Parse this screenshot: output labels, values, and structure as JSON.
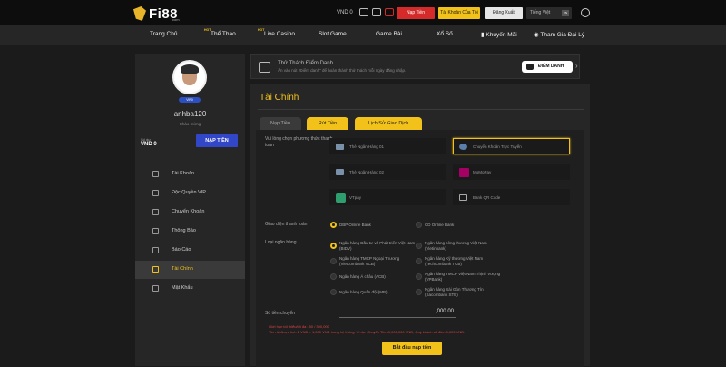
{
  "brand": {
    "name": "Fi88",
    "sub": "com"
  },
  "topbar": {
    "balance": "VND 0",
    "deposit_btn": "Nạp Tiền",
    "account_btn": "Tài Khoản Của Tôi",
    "logout_btn": "Đăng Xuất",
    "lang_btn": "Tiếng Việt",
    "lang_code": "VN"
  },
  "nav": [
    {
      "label": "Trang Chủ",
      "tag": ""
    },
    {
      "label": "Thể Thao",
      "tag": "HOT"
    },
    {
      "label": "Live Casino",
      "tag": "HOT"
    },
    {
      "label": "Slot Game",
      "tag": ""
    },
    {
      "label": "Game Bài",
      "tag": ""
    },
    {
      "label": "Xổ Số",
      "tag": ""
    },
    {
      "label": "Khuyến Mãi",
      "tag": ""
    },
    {
      "label": "Tham Gia Đại Lý",
      "tag": ""
    }
  ],
  "sidebar": {
    "vip": "VIP0",
    "username": "anhba120",
    "greeting": "Chào mừng",
    "balance_label": "Số dư",
    "balance_value": "VND 0",
    "deposit_btn": "NẠP TIỀN",
    "menu": [
      "Tài Khoản",
      "Độc Quyền VIP",
      "Chuyển Khoản",
      "Thông Báo",
      "Báo Cáo",
      "Tài Chính",
      "Mật Khẩu"
    ],
    "active": "Tài Chính"
  },
  "challenge": {
    "title": "Thử Thách Điểm Danh",
    "desc": "Ấn vào nút \"Điểm danh\" để hoàn thành thử thách mỗi ngày đăng nhập.",
    "button": "ĐIỂM DANH"
  },
  "finance": {
    "title": "Tài Chính",
    "tabs": [
      "Nạp Tiền",
      "Rút Tiền",
      "Lịch Sử Giao Dịch"
    ],
    "method_label": "Vui lòng chọn phương thức thanh toán",
    "methods": [
      "Thẻ Ngân Hàng 01",
      "Chuyển Khoản Trực Tuyến",
      "Thẻ Ngân Hàng 02",
      "MoMoPay",
      "VTpay",
      "Bank QR Code"
    ],
    "selected_method": "Chuyển Khoản Trực Tuyến",
    "interface_label": "Giao diện thanh toán",
    "interfaces": [
      "DBP Online Bank",
      "CD Online Bank"
    ],
    "bank_label": "Loại ngân hàng",
    "banks": [
      "Ngân hàng Đầu tư và Phát triển Việt Nam (BIDV)",
      "Ngân hàng công thương Việt Nam (Vietinbank)",
      "Ngân hàng TMCP Ngoại Thương (Vietcombank VCB)",
      "Ngân hàng Kỹ thương Việt Nam (Techcombank TCB)",
      "Ngân hàng Á châu (ACB)",
      "Ngân hàng TMCP Việt Nam Thịnh Vượng (VPBank)",
      "Ngân hàng Quân đội (MB)",
      "Ngân hàng Sài Gòn Thương Tín (Sacombank STB)"
    ],
    "amount_label": "Số tiền chuyển",
    "amount_value": ",000.00",
    "note_1": "Giới hạn tối thiểu/tối đa : 50 / 300,000",
    "note_2": "Tiền tệ được tính 1 VND = 1,000 VND trong hệ thống. Ví dụ: Chuyển Tiền 9,000,000 VND, Quý khách sẽ điền 9,000 VND.",
    "submit": "Bắt đầu nạp tiền"
  },
  "colors": {
    "accent": "#f2c21b",
    "danger": "#d42a2a",
    "primary": "#3246c8",
    "bg": "#1b1b1b",
    "panel": "#262626"
  }
}
